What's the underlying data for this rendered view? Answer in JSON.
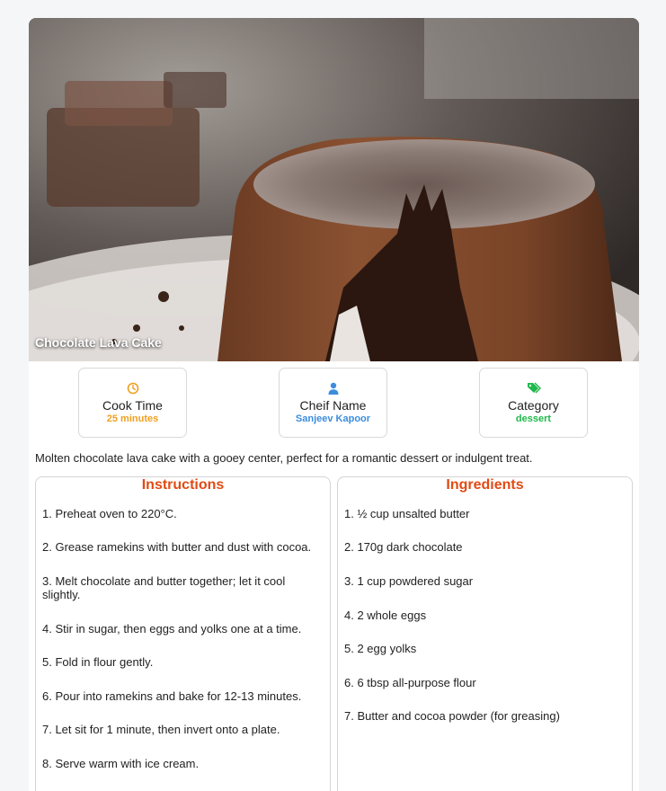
{
  "recipe": {
    "title": "Chocolate Lava Cake",
    "description": "Molten chocolate lava cake with a gooey center, perfect for a romantic dessert or indulgent treat."
  },
  "stats": [
    {
      "label": "Cook Time",
      "value": "25 minutes",
      "icon": "clock-icon",
      "color": "#f0a020"
    },
    {
      "label": "Cheif Name",
      "value": "Sanjeev Kapoor",
      "icon": "user-icon",
      "color": "#3b8ddd"
    },
    {
      "label": "Category",
      "value": "dessert",
      "icon": "tags-icon",
      "color": "#1fb84a"
    }
  ],
  "instructions": {
    "heading": "Instructions",
    "steps": [
      "1. Preheat oven to 220°C.",
      "2. Grease ramekins with butter and dust with cocoa.",
      "3. Melt chocolate and butter together; let it cool slightly.",
      "4. Stir in sugar, then eggs and yolks one at a time.",
      "5. Fold in flour gently.",
      "6. Pour into ramekins and bake for 12-13 minutes.",
      "7. Let sit for 1 minute, then invert onto a plate.",
      "8. Serve warm with ice cream."
    ]
  },
  "ingredients": {
    "heading": "Ingredients",
    "items": [
      "1. ½ cup unsalted butter",
      "2. 170g dark chocolate",
      "3. 1 cup powdered sugar",
      "4. 2 whole eggs",
      "5. 2 egg yolks",
      "6. 6 tbsp all-purpose flour",
      "7. Butter and cocoa powder (for greasing)"
    ]
  },
  "colors": {
    "heading": "#e14b14",
    "cook_time": "#f0a020",
    "chef": "#3b8ddd",
    "category": "#1fb84a"
  }
}
